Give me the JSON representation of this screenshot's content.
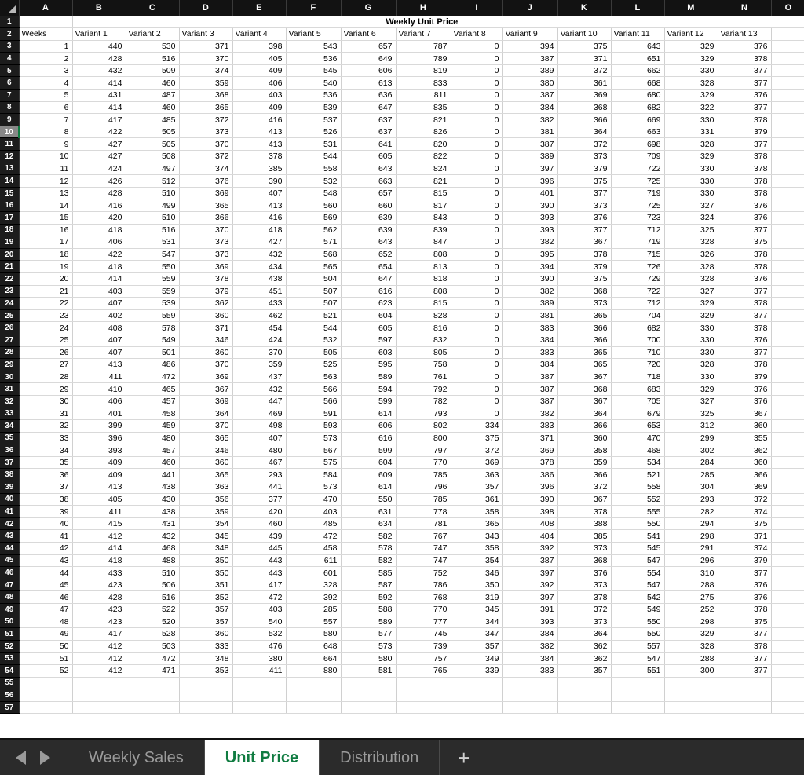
{
  "spreadsheet": {
    "title": "Weekly Unit Price",
    "column_letters": [
      "A",
      "B",
      "C",
      "D",
      "E",
      "F",
      "G",
      "H",
      "I",
      "J",
      "K",
      "L",
      "M",
      "N",
      "O"
    ],
    "select_all_icon": "select-all-triangle",
    "selected_row": 10,
    "first_visible_row": 1,
    "last_visible_row": 57,
    "empty_rows": [
      55,
      56,
      57
    ],
    "headers": [
      "Weeks",
      "Variant 1",
      "Variant 2",
      "Variant 3",
      "Variant 4",
      "Variant 5",
      "Variant 6",
      "Variant 7",
      "Variant 8",
      "Variant 9",
      "Variant 10",
      "Variant 11",
      "Variant 12",
      "Variant 13"
    ],
    "rows": [
      [
        1,
        440,
        530,
        371,
        398,
        543,
        657,
        787,
        0,
        394,
        375,
        643,
        329,
        376
      ],
      [
        2,
        428,
        516,
        370,
        405,
        536,
        649,
        789,
        0,
        387,
        371,
        651,
        329,
        378
      ],
      [
        3,
        432,
        509,
        374,
        409,
        545,
        606,
        819,
        0,
        389,
        372,
        662,
        330,
        377
      ],
      [
        4,
        414,
        460,
        359,
        406,
        540,
        613,
        833,
        0,
        380,
        361,
        668,
        328,
        377
      ],
      [
        5,
        431,
        487,
        368,
        403,
        536,
        636,
        811,
        0,
        387,
        369,
        680,
        329,
        376
      ],
      [
        6,
        414,
        460,
        365,
        409,
        539,
        647,
        835,
        0,
        384,
        368,
        682,
        322,
        377
      ],
      [
        7,
        417,
        485,
        372,
        416,
        537,
        637,
        821,
        0,
        382,
        366,
        669,
        330,
        378
      ],
      [
        8,
        422,
        505,
        373,
        413,
        526,
        637,
        826,
        0,
        381,
        364,
        663,
        331,
        379
      ],
      [
        9,
        427,
        505,
        370,
        413,
        531,
        641,
        820,
        0,
        387,
        372,
        698,
        328,
        377
      ],
      [
        10,
        427,
        508,
        372,
        378,
        544,
        605,
        822,
        0,
        389,
        373,
        709,
        329,
        378
      ],
      [
        11,
        424,
        497,
        374,
        385,
        558,
        643,
        824,
        0,
        397,
        379,
        722,
        330,
        378
      ],
      [
        12,
        426,
        512,
        376,
        390,
        532,
        663,
        821,
        0,
        396,
        375,
        725,
        330,
        378
      ],
      [
        13,
        428,
        510,
        369,
        407,
        548,
        657,
        815,
        0,
        401,
        377,
        719,
        330,
        378
      ],
      [
        14,
        416,
        499,
        365,
        413,
        560,
        660,
        817,
        0,
        390,
        373,
        725,
        327,
        376
      ],
      [
        15,
        420,
        510,
        366,
        416,
        569,
        639,
        843,
        0,
        393,
        376,
        723,
        324,
        376
      ],
      [
        16,
        418,
        516,
        370,
        418,
        562,
        639,
        839,
        0,
        393,
        377,
        712,
        325,
        377
      ],
      [
        17,
        406,
        531,
        373,
        427,
        571,
        643,
        847,
        0,
        382,
        367,
        719,
        328,
        375
      ],
      [
        18,
        422,
        547,
        373,
        432,
        568,
        652,
        808,
        0,
        395,
        378,
        715,
        326,
        378
      ],
      [
        19,
        418,
        550,
        369,
        434,
        565,
        654,
        813,
        0,
        394,
        379,
        726,
        328,
        378
      ],
      [
        20,
        414,
        559,
        378,
        438,
        504,
        647,
        818,
        0,
        390,
        375,
        729,
        328,
        376
      ],
      [
        21,
        403,
        559,
        379,
        451,
        507,
        616,
        808,
        0,
        382,
        368,
        722,
        327,
        377
      ],
      [
        22,
        407,
        539,
        362,
        433,
        507,
        623,
        815,
        0,
        389,
        373,
        712,
        329,
        378
      ],
      [
        23,
        402,
        559,
        360,
        462,
        521,
        604,
        828,
        0,
        381,
        365,
        704,
        329,
        377
      ],
      [
        24,
        408,
        578,
        371,
        454,
        544,
        605,
        816,
        0,
        383,
        366,
        682,
        330,
        378
      ],
      [
        25,
        407,
        549,
        346,
        424,
        532,
        597,
        832,
        0,
        384,
        366,
        700,
        330,
        376
      ],
      [
        26,
        407,
        501,
        360,
        370,
        505,
        603,
        805,
        0,
        383,
        365,
        710,
        330,
        377
      ],
      [
        27,
        413,
        486,
        370,
        359,
        525,
        595,
        758,
        0,
        384,
        365,
        720,
        328,
        378
      ],
      [
        28,
        411,
        472,
        369,
        437,
        563,
        589,
        761,
        0,
        387,
        367,
        718,
        330,
        379
      ],
      [
        29,
        410,
        465,
        367,
        432,
        566,
        594,
        792,
        0,
        387,
        368,
        683,
        329,
        376
      ],
      [
        30,
        406,
        457,
        369,
        447,
        566,
        599,
        782,
        0,
        387,
        367,
        705,
        327,
        376
      ],
      [
        31,
        401,
        458,
        364,
        469,
        591,
        614,
        793,
        0,
        382,
        364,
        679,
        325,
        367
      ],
      [
        32,
        399,
        459,
        370,
        498,
        593,
        606,
        802,
        334,
        383,
        366,
        653,
        312,
        360
      ],
      [
        33,
        396,
        480,
        365,
        407,
        573,
        616,
        800,
        375,
        371,
        360,
        470,
        299,
        355
      ],
      [
        34,
        393,
        457,
        346,
        480,
        567,
        599,
        797,
        372,
        369,
        358,
        468,
        302,
        362
      ],
      [
        35,
        409,
        460,
        360,
        467,
        575,
        604,
        770,
        369,
        378,
        359,
        534,
        284,
        360
      ],
      [
        36,
        409,
        441,
        365,
        293,
        584,
        609,
        785,
        363,
        386,
        366,
        521,
        285,
        366
      ],
      [
        37,
        413,
        438,
        363,
        441,
        573,
        614,
        796,
        357,
        396,
        372,
        558,
        304,
        369
      ],
      [
        38,
        405,
        430,
        356,
        377,
        470,
        550,
        785,
        361,
        390,
        367,
        552,
        293,
        372
      ],
      [
        39,
        411,
        438,
        359,
        420,
        403,
        631,
        778,
        358,
        398,
        378,
        555,
        282,
        374
      ],
      [
        40,
        415,
        431,
        354,
        460,
        485,
        634,
        781,
        365,
        408,
        388,
        550,
        294,
        375
      ],
      [
        41,
        412,
        432,
        345,
        439,
        472,
        582,
        767,
        343,
        404,
        385,
        541,
        298,
        371
      ],
      [
        42,
        414,
        468,
        348,
        445,
        458,
        578,
        747,
        358,
        392,
        373,
        545,
        291,
        374
      ],
      [
        43,
        418,
        488,
        350,
        443,
        611,
        582,
        747,
        354,
        387,
        368,
        547,
        296,
        379
      ],
      [
        44,
        433,
        510,
        350,
        443,
        601,
        585,
        752,
        346,
        397,
        376,
        554,
        310,
        377
      ],
      [
        45,
        423,
        506,
        351,
        417,
        328,
        587,
        786,
        350,
        392,
        373,
        547,
        288,
        376
      ],
      [
        46,
        428,
        516,
        352,
        472,
        392,
        592,
        768,
        319,
        397,
        378,
        542,
        275,
        376
      ],
      [
        47,
        423,
        522,
        357,
        403,
        285,
        588,
        770,
        345,
        391,
        372,
        549,
        252,
        378
      ],
      [
        48,
        423,
        520,
        357,
        540,
        557,
        589,
        777,
        344,
        393,
        373,
        550,
        298,
        375
      ],
      [
        49,
        417,
        528,
        360,
        532,
        580,
        577,
        745,
        347,
        384,
        364,
        550,
        329,
        377
      ],
      [
        50,
        412,
        503,
        333,
        476,
        648,
        573,
        739,
        357,
        382,
        362,
        557,
        328,
        378
      ],
      [
        51,
        412,
        472,
        348,
        380,
        664,
        580,
        757,
        349,
        384,
        362,
        547,
        288,
        377
      ],
      [
        52,
        412,
        471,
        353,
        411,
        880,
        581,
        765,
        339,
        383,
        357,
        551,
        300,
        377
      ]
    ]
  },
  "tabbar": {
    "prev_icon": "prev-sheet-arrow",
    "next_icon": "next-sheet-arrow",
    "add_label": "+",
    "tabs": [
      {
        "label": "Weekly Sales",
        "active": false
      },
      {
        "label": "Unit Price",
        "active": true
      },
      {
        "label": "Distribution",
        "active": false
      }
    ]
  },
  "colors": {
    "accent_green": "#107c41",
    "header_dark": "#121212",
    "tabbar_bg": "#2b2b2b"
  }
}
